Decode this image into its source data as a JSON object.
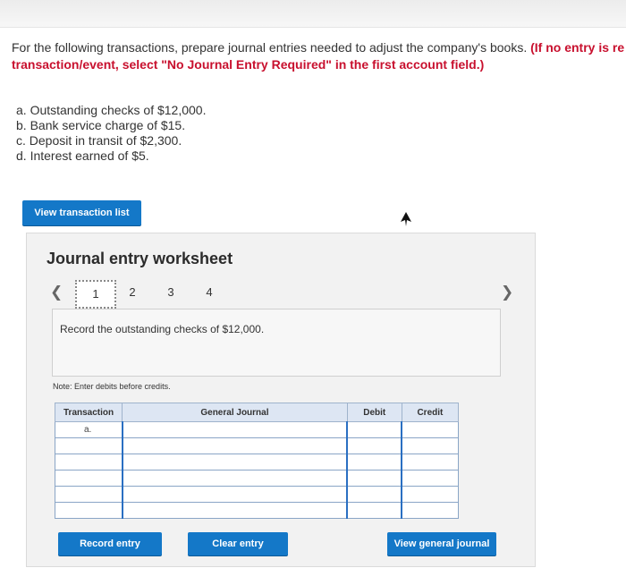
{
  "instructions": {
    "part1": "For the following transactions, prepare journal entries needed to adjust the company's books.",
    "part2": " (If no entry is re",
    "part3": "transaction/event, select \"No Journal Entry Required\" in the first account field.)"
  },
  "transactions": [
    "a. Outstanding checks of $12,000.",
    "b. Bank service charge of $15.",
    "c. Deposit in transit of $2,300.",
    "d. Interest earned of $5."
  ],
  "view_transaction_list_label": "View transaction list",
  "worksheet": {
    "title": "Journal entry worksheet",
    "pages": [
      "1",
      "2",
      "3",
      "4"
    ],
    "current_page": "1",
    "prompt": "Record the outstanding checks of $12,000.",
    "note": "Note: Enter debits before credits.",
    "table": {
      "headers": [
        "Transaction",
        "General Journal",
        "Debit",
        "Credit"
      ],
      "rows": [
        {
          "transaction": "a.",
          "account": "",
          "debit": "",
          "credit": ""
        },
        {
          "transaction": "",
          "account": "",
          "debit": "",
          "credit": ""
        },
        {
          "transaction": "",
          "account": "",
          "debit": "",
          "credit": ""
        },
        {
          "transaction": "",
          "account": "",
          "debit": "",
          "credit": ""
        },
        {
          "transaction": "",
          "account": "",
          "debit": "",
          "credit": ""
        },
        {
          "transaction": "",
          "account": "",
          "debit": "",
          "credit": ""
        }
      ]
    },
    "buttons": {
      "record": "Record entry",
      "clear": "Clear entry",
      "view_journal": "View general journal"
    }
  },
  "colors": {
    "accent": "#1478c8",
    "emphasis_red": "#c8102e",
    "table_header": "#dde6f3",
    "panel_bg": "#f2f2f2"
  }
}
